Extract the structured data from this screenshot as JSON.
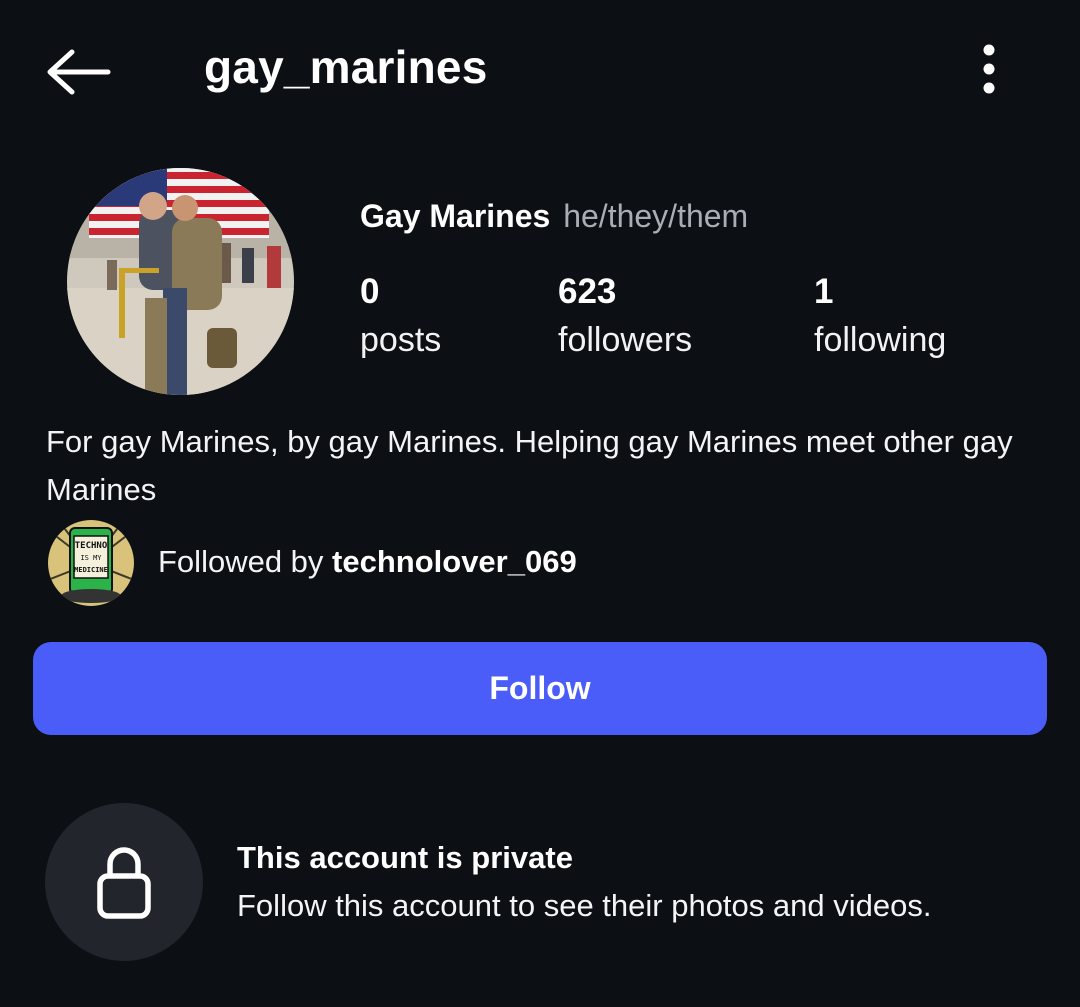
{
  "header": {
    "username": "gay_marines",
    "back_icon": "arrow-left-icon",
    "menu_icon": "more-vertical-icon"
  },
  "profile": {
    "display_name": "Gay Marines",
    "pronouns": "he/they/them",
    "stats": {
      "posts": {
        "value": "0",
        "label": "posts"
      },
      "followers": {
        "value": "623",
        "label": "followers"
      },
      "following": {
        "value": "1",
        "label": "following"
      }
    },
    "bio": "For gay Marines, by gay Marines. Helping gay Marines meet other gay Marines",
    "followed_by": {
      "prefix": "Followed by ",
      "username": "technolover_069",
      "avatar_lettering": [
        "TECHNO",
        "IS MY",
        "MEDICINE"
      ]
    }
  },
  "actions": {
    "follow_label": "Follow"
  },
  "private_notice": {
    "icon": "lock-icon",
    "title": "This account is private",
    "description": "Follow this account to see their photos and videos."
  },
  "colors": {
    "background": "#0c0f14",
    "primary_button": "#4a5df9",
    "muted_text": "#a8adb6",
    "icon_circle": "#22252b"
  }
}
